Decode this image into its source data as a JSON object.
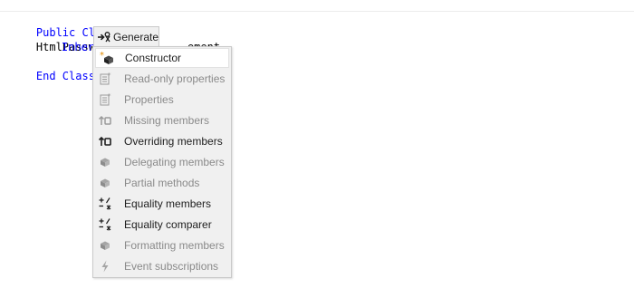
{
  "editor": {
    "line1": {
      "keyword": "Public Class",
      "name": "HtmlPassword"
    },
    "line2": {
      "keyword": "Inherits",
      "visible_tail": "ement"
    },
    "line3": {
      "keyword": "End Class"
    }
  },
  "generate_popup": {
    "title": "Generate",
    "items": [
      {
        "label": "Constructor",
        "enabled": true,
        "selected": true,
        "icon": "constructor-icon"
      },
      {
        "label": "Read-only properties",
        "enabled": false,
        "icon": "readonly-properties-icon"
      },
      {
        "label": "Properties",
        "enabled": false,
        "icon": "properties-icon"
      },
      {
        "label": "Missing members",
        "enabled": false,
        "icon": "missing-members-icon"
      },
      {
        "label": "Overriding members",
        "enabled": true,
        "icon": "overriding-members-icon"
      },
      {
        "label": "Delegating members",
        "enabled": false,
        "icon": "delegating-members-icon"
      },
      {
        "label": "Partial methods",
        "enabled": false,
        "icon": "partial-methods-icon"
      },
      {
        "label": "Equality members",
        "enabled": true,
        "icon": "equality-members-icon"
      },
      {
        "label": "Equality comparer",
        "enabled": true,
        "icon": "equality-comparer-icon"
      },
      {
        "label": "Formatting members",
        "enabled": false,
        "icon": "formatting-members-icon"
      },
      {
        "label": "Event subscriptions",
        "enabled": false,
        "icon": "event-subscriptions-icon"
      }
    ]
  },
  "colors": {
    "keyword": "#0000ff",
    "text": "#000000",
    "menu_bg": "#f0f0f0",
    "disabled_text": "#8a8a8a"
  }
}
